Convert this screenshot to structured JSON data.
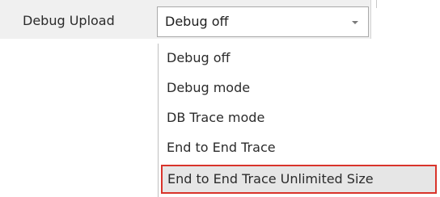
{
  "form": {
    "field_label": "Debug Upload",
    "select": {
      "value": "Debug off",
      "arrow_icon": "chevron-down-icon"
    }
  },
  "dropdown": {
    "options": [
      {
        "label": "Debug off"
      },
      {
        "label": "Debug mode"
      },
      {
        "label": "DB Trace mode"
      },
      {
        "label": "End to End Trace"
      },
      {
        "label": "End to End Trace Unlimited Size",
        "highlighted": true
      }
    ]
  },
  "colors": {
    "highlight_border": "#d9342b",
    "highlight_background": "#e6e6e6"
  }
}
